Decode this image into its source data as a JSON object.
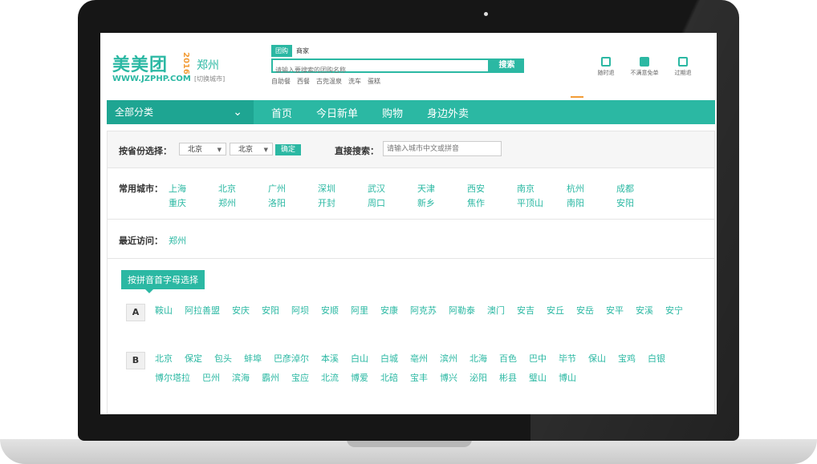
{
  "header": {
    "logo_text": "美美团",
    "logo_year": "2016",
    "logo_url": "WWW.JZPHP.COM",
    "city": "郑州",
    "switch_city": "[切换城市]"
  },
  "search": {
    "tabs": [
      "团购",
      "商家"
    ],
    "placeholder": "请输入要搜索的团购名称",
    "button": "搜索",
    "hot_words": [
      "自助餐",
      "西餐",
      "古兜温泉",
      "洗车",
      "蛋糕"
    ]
  },
  "services": [
    "随时退",
    "不满意免单",
    "过期退"
  ],
  "nav": {
    "all_categories": "全部分类",
    "items": [
      "首页",
      "今日新单",
      "购物",
      "身边外卖"
    ]
  },
  "province_select": {
    "label": "按省份选择：",
    "province": "北京",
    "city": "北京",
    "confirm": "确定",
    "direct_label": "直接搜索：",
    "direct_placeholder": "请输入城市中文或拼音"
  },
  "common_cities": {
    "label": "常用城市：",
    "cities": [
      "上海",
      "北京",
      "广州",
      "深圳",
      "武汉",
      "天津",
      "西安",
      "南京",
      "杭州",
      "成都",
      "重庆",
      "郑州",
      "洛阳",
      "开封",
      "周口",
      "新乡",
      "焦作",
      "平顶山",
      "南阳",
      "安阳"
    ]
  },
  "recent": {
    "label": "最近访问：",
    "city": "郑州"
  },
  "pinyin": {
    "label": "按拼音首字母选择",
    "groups": [
      {
        "letter": "A",
        "cities": [
          "鞍山",
          "阿拉善盟",
          "安庆",
          "安阳",
          "阿坝",
          "安顺",
          "阿里",
          "安康",
          "阿克苏",
          "阿勒泰",
          "澳门",
          "安吉",
          "安丘",
          "安岳",
          "安平",
          "安溪",
          "安宁"
        ]
      },
      {
        "letter": "B",
        "cities": [
          "北京",
          "保定",
          "包头",
          "蚌埠",
          "巴彦淖尔",
          "本溪",
          "白山",
          "白城",
          "亳州",
          "滨州",
          "北海",
          "百色",
          "巴中",
          "毕节",
          "保山",
          "宝鸡",
          "白银",
          "博尔塔拉",
          "巴州",
          "滨海",
          "霸州",
          "宝应",
          "北流",
          "博爱",
          "北碚",
          "宝丰",
          "博兴",
          "泌阳",
          "彬县",
          "璧山",
          "博山"
        ]
      }
    ]
  }
}
